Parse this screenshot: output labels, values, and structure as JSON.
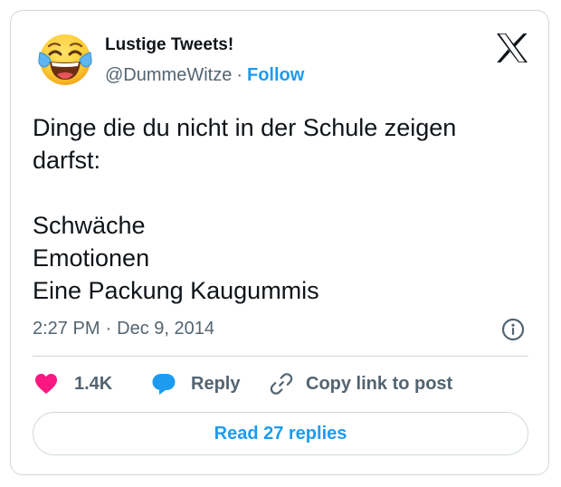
{
  "author": {
    "name": "Lustige Tweets!",
    "handle": "@DummeWitze",
    "separator": "·",
    "follow_label": "Follow",
    "avatar_icon": "face-with-tears-of-joy-emoji"
  },
  "brand": {
    "logo_icon": "x-logo"
  },
  "tweet": {
    "lines": [
      "Dinge die du nicht in der Schule zeigen",
      "darfst:",
      "",
      "Schwäche",
      "Emotionen",
      "Eine Packung Kaugummis"
    ]
  },
  "meta": {
    "time": "2:27 PM",
    "separator": "·",
    "date": "Dec 9, 2014",
    "info_icon": "info-circle-icon"
  },
  "actions": {
    "like": {
      "icon": "heart-icon",
      "count": "1.4K"
    },
    "reply": {
      "icon": "speech-bubble-icon",
      "label": "Reply"
    },
    "copy_link": {
      "icon": "link-icon",
      "label": "Copy link to post"
    }
  },
  "read_replies": {
    "label": "Read 27 replies"
  },
  "colors": {
    "accent": "#1d9bf0",
    "like": "#f91880",
    "secondary_text": "#536471",
    "border": "#cfd9de",
    "primary_text": "#0f1419"
  }
}
